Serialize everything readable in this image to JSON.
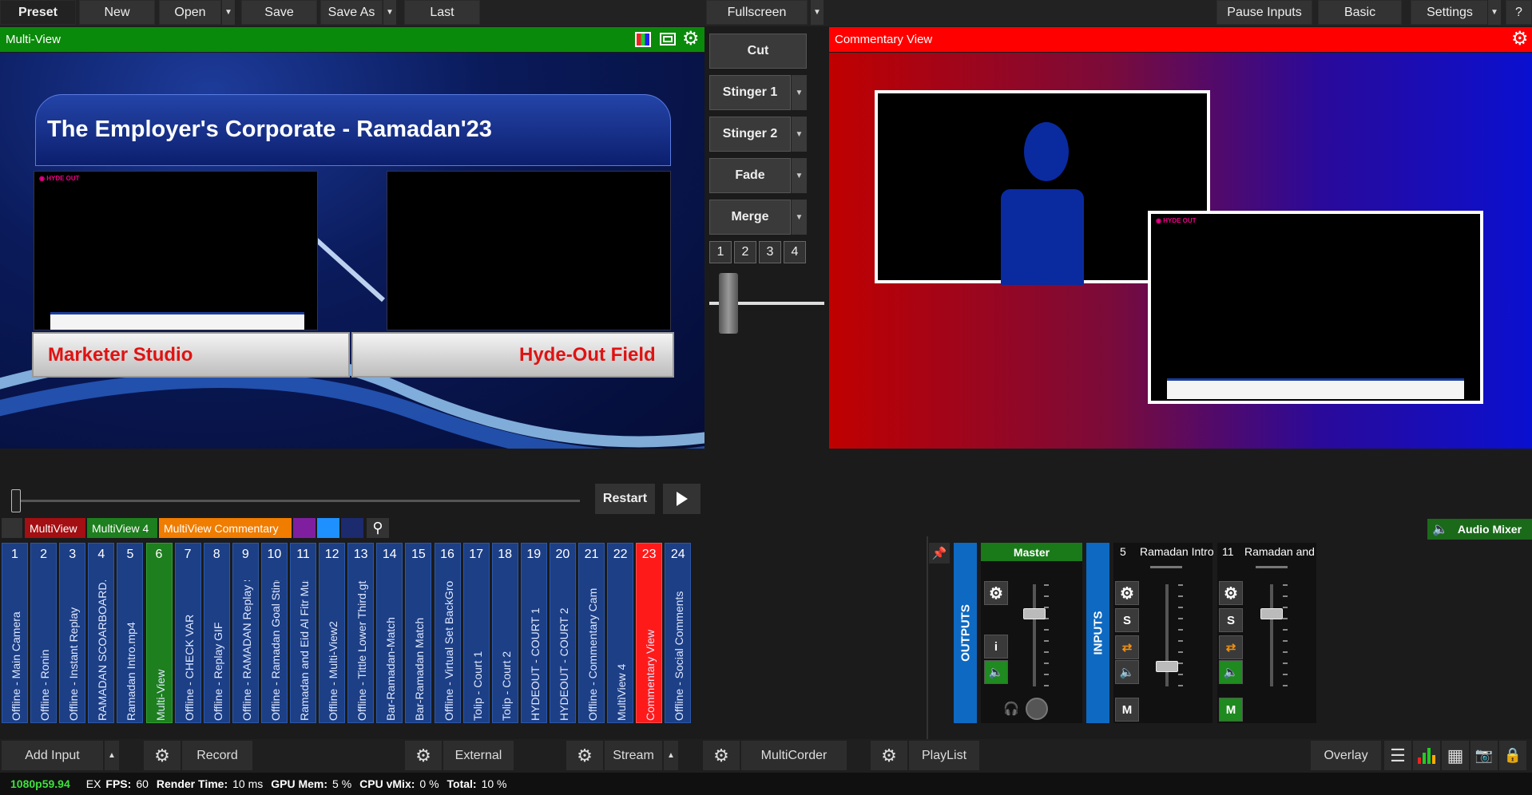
{
  "topbar": {
    "preset": "Preset",
    "new": "New",
    "open": "Open",
    "save": "Save",
    "save_as": "Save As",
    "last": "Last",
    "fullscreen": "Fullscreen",
    "pause_inputs": "Pause Inputs",
    "basic": "Basic",
    "settings": "Settings",
    "help": "?"
  },
  "preview": {
    "title": "Multi-View",
    "overlay_title": "The Employer's Corporate - Ramadan'23",
    "left_label": "Marketer Studio",
    "right_label": "Hyde-Out Field"
  },
  "output": {
    "title": "Commentary View"
  },
  "transitions": {
    "cut": "Cut",
    "stinger1": "Stinger 1",
    "stinger2": "Stinger 2",
    "fade": "Fade",
    "merge": "Merge",
    "numbers": [
      "1",
      "2",
      "3",
      "4"
    ],
    "tbar_position": 0.1
  },
  "playback": {
    "restart": "Restart",
    "position": 0.0
  },
  "input_tabs": [
    {
      "label": "MultiView",
      "color": "#a30f12"
    },
    {
      "label": "MultiView 4",
      "color": "#1d7f1d"
    },
    {
      "label": "MultiView Commentary",
      "color": "#f07c00"
    },
    {
      "label": "",
      "color": "#7f1fa0"
    },
    {
      "label": "",
      "color": "#1e90ff"
    },
    {
      "label": "",
      "color": "#1c2a6e"
    }
  ],
  "inputs": [
    {
      "n": "1",
      "label": "Offline - Main Camera",
      "state": "idle"
    },
    {
      "n": "2",
      "label": "Offline - Ronin",
      "state": "idle"
    },
    {
      "n": "3",
      "label": "Offline - Instant Replay",
      "state": "idle"
    },
    {
      "n": "4",
      "label": "RAMADAN SCOARBOARD.gtz",
      "state": "idle"
    },
    {
      "n": "5",
      "label": "Ramadan Intro.mp4",
      "state": "idle"
    },
    {
      "n": "6",
      "label": "Multi-View",
      "state": "preview"
    },
    {
      "n": "7",
      "label": "Offline - CHECK VAR",
      "state": "idle"
    },
    {
      "n": "8",
      "label": "Offline - Replay GIF",
      "state": "idle"
    },
    {
      "n": "9",
      "label": "Offline - RAMADAN Replay Sti",
      "state": "idle"
    },
    {
      "n": "10",
      "label": "Offline - Ramadan Goal Stinge",
      "state": "idle"
    },
    {
      "n": "11",
      "label": "Ramadan and Eid Al Fitr Music",
      "state": "idle"
    },
    {
      "n": "12",
      "label": "Offline - Multi-View2",
      "state": "idle"
    },
    {
      "n": "13",
      "label": "Offline - Tittle Lower Third.gtzi",
      "state": "idle"
    },
    {
      "n": "14",
      "label": "Bar-Ramadan-Match",
      "state": "idle"
    },
    {
      "n": "15",
      "label": "Bar-Ramadan Match",
      "state": "idle"
    },
    {
      "n": "16",
      "label": "Offline - Virtual Set BackGrour",
      "state": "idle"
    },
    {
      "n": "17",
      "label": "Tolip - Court 1",
      "state": "idle"
    },
    {
      "n": "18",
      "label": "Tolip - Court 2",
      "state": "idle"
    },
    {
      "n": "19",
      "label": "HYDEOUT - COURT 1",
      "state": "idle"
    },
    {
      "n": "20",
      "label": "HYDEOUT - COURT 2",
      "state": "idle"
    },
    {
      "n": "21",
      "label": "Offline - Commentary Cam",
      "state": "idle"
    },
    {
      "n": "22",
      "label": "MultiView 4",
      "state": "idle"
    },
    {
      "n": "23",
      "label": "Commentary View",
      "state": "program"
    },
    {
      "n": "24",
      "label": "Offline - Social Comments",
      "state": "idle"
    }
  ],
  "audio": {
    "title": "Audio Mixer",
    "outputs": "OUTPUTS",
    "inputs_label": "INPUTS",
    "master": "Master",
    "info": "i",
    "ch1_num": "5",
    "ch1_name": "Ramadan Intro",
    "ch2_num": "11",
    "ch2_name": "Ramadan and",
    "solo": "S",
    "mute": "M",
    "master_level": 0.75,
    "ch1_level": 0.2,
    "ch2_level": 0.75
  },
  "bottombar": {
    "add_input": "Add Input",
    "record": "Record",
    "external": "External",
    "stream": "Stream",
    "multicorder": "MultiCorder",
    "playlist": "PlayList",
    "overlay": "Overlay"
  },
  "status": {
    "format": "1080p59.94",
    "ex": "EX",
    "fps_label": "FPS:",
    "fps": "60",
    "render_label": "Render Time:",
    "render": "10 ms",
    "gpu_label": "GPU Mem:",
    "gpu": "5 %",
    "cpu_label": "CPU vMix:",
    "cpu": "0 %",
    "total_label": "Total:",
    "total": "10 %"
  },
  "colors": {
    "preview_bar": "#0a8a0a",
    "program_bar": "#ff0000",
    "tile_idle": "#1c3f86",
    "tile_preview": "#1d7f1d",
    "tile_program": "#ff1a1a"
  }
}
